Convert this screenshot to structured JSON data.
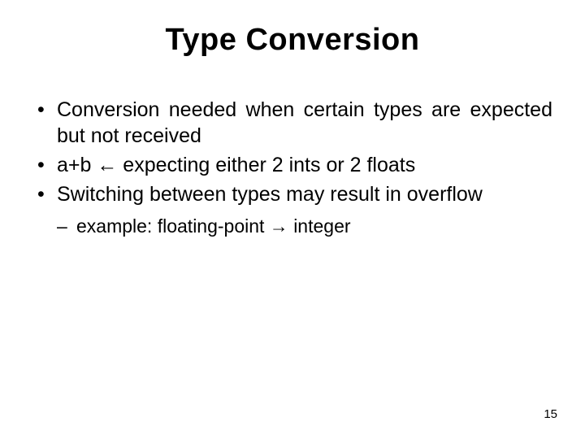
{
  "title": "Type  Conversion",
  "bullets": [
    "Conversion needed when certain types are expected but not received",
    "a+b ← expecting either 2 ints or 2 floats",
    "Switching between types may result in overflow"
  ],
  "sub_bullet": "example:  floating-point → integer",
  "page_number": "15"
}
